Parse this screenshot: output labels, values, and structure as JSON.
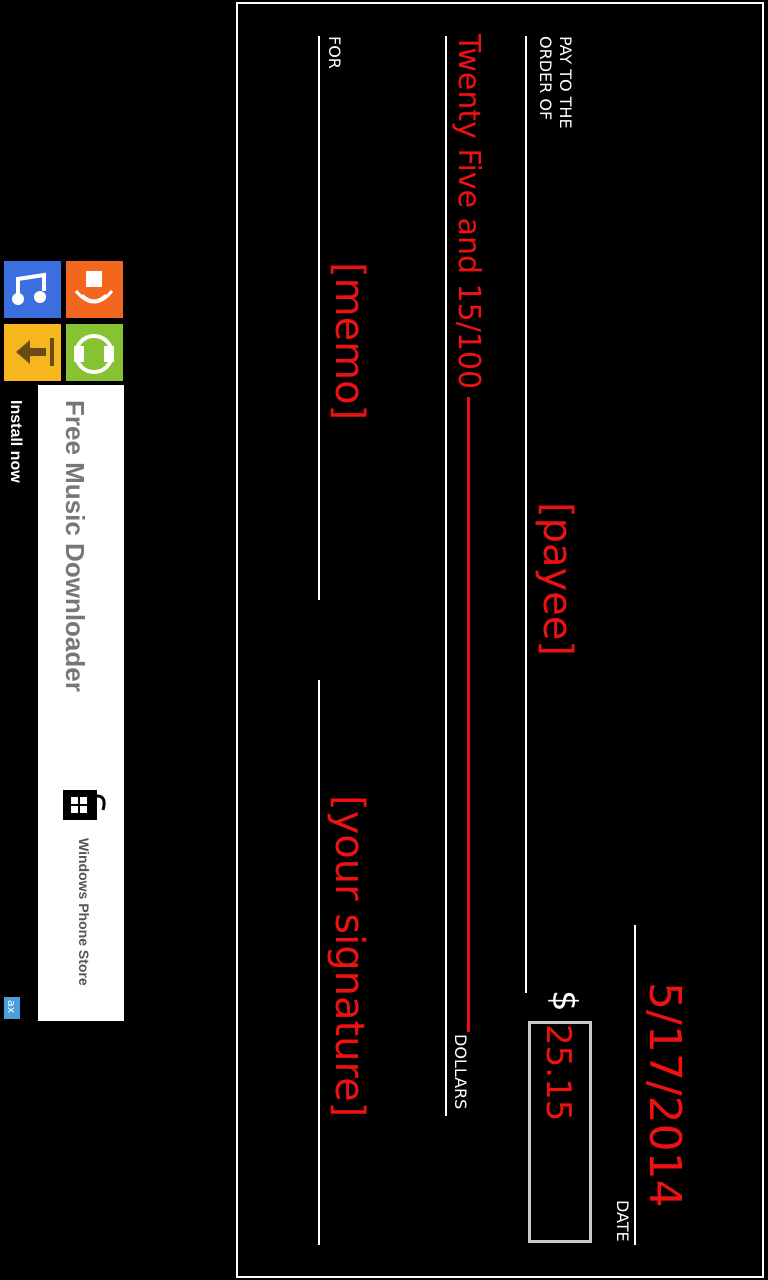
{
  "check": {
    "date_label": "DATE",
    "date_value": "5/17/2014",
    "pay_to_label_line1": "PAY TO THE",
    "pay_to_label_line2": "ORDER OF",
    "payee": "[payee]",
    "dollar_sign": "$",
    "amount": "25.15",
    "amount_words": "Twenty Five and 15/100",
    "dollars_label": "DOLLARS",
    "for_label": "FOR",
    "memo": "[memo]",
    "signature": "[your signature]"
  },
  "ad": {
    "title": "Free Music Downloader",
    "store": "Windows Phone Store",
    "cta": "Install now",
    "ad_mark": "ax",
    "tile_colors": [
      "#3b6fe0",
      "#f2661e",
      "#f7b51e",
      "#86c232"
    ],
    "tile_icons": [
      "music-note-icon",
      "speaker-icon",
      "download-arrow-icon",
      "headphones-icon"
    ]
  }
}
